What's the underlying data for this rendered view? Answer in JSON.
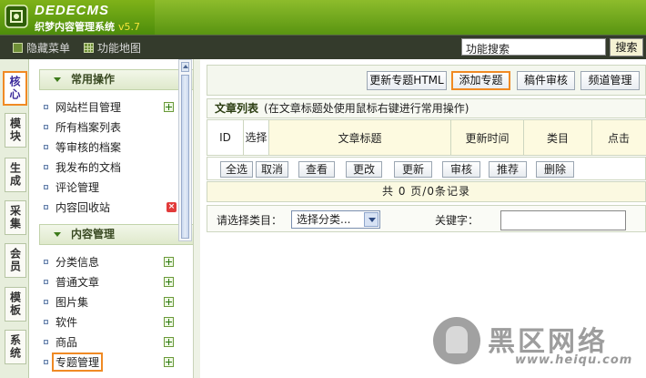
{
  "header": {
    "logo_main": "DEDECMS",
    "logo_sub": "织梦内容管理系统",
    "version": "v5.7"
  },
  "toolbar": {
    "hide_menu": "隐藏菜单",
    "site_map": "功能地图",
    "search_placeholder": "功能搜索",
    "search_button": "搜索"
  },
  "vtabs": [
    "核心",
    "模块",
    "生成",
    "采集",
    "会员",
    "模板",
    "系统"
  ],
  "menu": {
    "section1": "常用操作",
    "items1": [
      "网站栏目管理",
      "所有档案列表",
      "等审核的档案",
      "我发布的文档",
      "评论管理",
      "内容回收站"
    ],
    "section2": "内容管理",
    "items2": [
      "分类信息",
      "普通文章",
      "图片集",
      "软件",
      "商品",
      "专题管理"
    ]
  },
  "main": {
    "buttons": [
      "更新专题HTML",
      "添加专题",
      "稿件审核",
      "频道管理"
    ],
    "list_title": "文章列表",
    "list_hint": "(在文章标题处使用鼠标右键进行常用操作)",
    "columns": [
      "ID",
      "选择",
      "文章标题",
      "更新时间",
      "类目",
      "点击"
    ],
    "actions": [
      "全选",
      "取消",
      "查看",
      "更改",
      "更新",
      "审核",
      "推荐",
      "删除"
    ],
    "pager": "共 0 页/0条记录",
    "filter_label": "请选择类目：",
    "filter_select": "选择分类...",
    "keyword_label": "关键字："
  },
  "watermark": {
    "text": "黑区网络",
    "url": "www.heiqu.com"
  }
}
